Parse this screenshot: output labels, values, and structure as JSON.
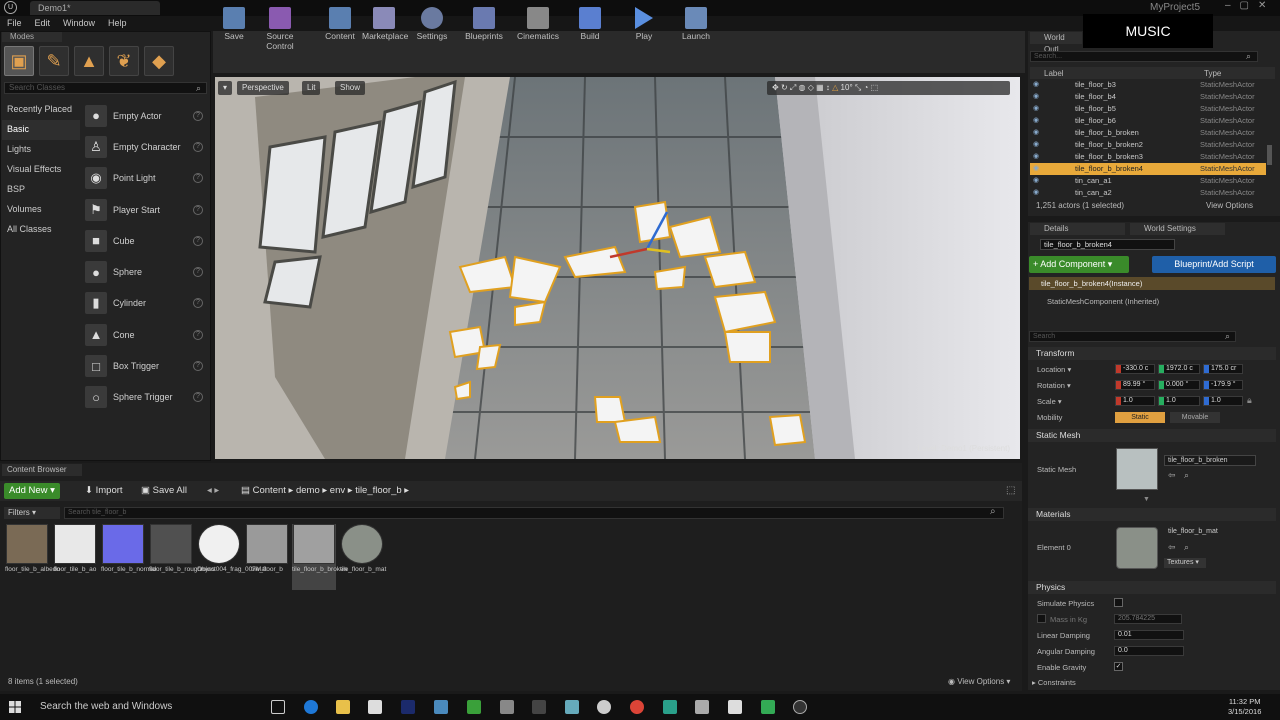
{
  "window": {
    "tab_title": "Demo1*",
    "project_name": "MyProject5",
    "menu": [
      "File",
      "Edit",
      "Window",
      "Help"
    ],
    "overlay_label": "MUSIC"
  },
  "modes": {
    "tab": "Modes",
    "search_placeholder": "Search Classes",
    "categories": [
      "Recently Placed",
      "Basic",
      "Lights",
      "Visual Effects",
      "BSP",
      "Volumes",
      "All Classes"
    ],
    "selected_category": "Basic",
    "classes": [
      "Empty Actor",
      "Empty Character",
      "Point Light",
      "Player Start",
      "Cube",
      "Sphere",
      "Cylinder",
      "Cone",
      "Box Trigger",
      "Sphere Trigger"
    ]
  },
  "toolbar": {
    "buttons": [
      "Save",
      "Source Control",
      "Content",
      "Marketplace",
      "Settings",
      "Blueprints",
      "Cinematics",
      "Build",
      "Play",
      "Launch"
    ]
  },
  "viewport": {
    "perspective": "Perspective",
    "lit": "Lit",
    "show": "Show",
    "snap_angle": "10°",
    "level_label": "Level: Demo1 (Persistent)"
  },
  "outliner": {
    "tabs": [
      "World Outl..."
    ],
    "search_placeholder": "Search...",
    "col_label": "Label",
    "col_type": "Type",
    "rows": [
      {
        "label": "tile_floor_b3",
        "type": "StaticMeshActor"
      },
      {
        "label": "tile_floor_b4",
        "type": "StaticMeshActor"
      },
      {
        "label": "tile_floor_b5",
        "type": "StaticMeshActor"
      },
      {
        "label": "tile_floor_b6",
        "type": "StaticMeshActor"
      },
      {
        "label": "tile_floor_b_broken",
        "type": "StaticMeshActor"
      },
      {
        "label": "tile_floor_b_broken2",
        "type": "StaticMeshActor"
      },
      {
        "label": "tile_floor_b_broken3",
        "type": "StaticMeshActor"
      },
      {
        "label": "tile_floor_b_broken4",
        "type": "StaticMeshActor"
      },
      {
        "label": "tin_can_a1",
        "type": "StaticMeshActor"
      },
      {
        "label": "tin_can_a2",
        "type": "StaticMeshActor"
      }
    ],
    "footer": "1,251 actors (1 selected)",
    "view_options": "View Options"
  },
  "details": {
    "tabs": [
      "Details",
      "World Settings"
    ],
    "actor_name": "tile_floor_b_broken4",
    "add_component": "+ Add Component ▾",
    "blueprint_script": "Blueprint/Add Script",
    "components": [
      "tile_floor_b_broken4(Instance)",
      "StaticMeshComponent (Inherited)"
    ],
    "search_placeholder": "Search",
    "transform": {
      "title": "Transform",
      "location_label": "Location ▾",
      "rotation_label": "Rotation ▾",
      "scale_label": "Scale ▾",
      "mobility_label": "Mobility",
      "location": [
        "-330.0 c",
        "1972.0 c",
        "175.0 cr"
      ],
      "rotation": [
        "89.99 °",
        "0.000 °",
        "-179.9 °"
      ],
      "scale": [
        "1.0",
        "1.0",
        "1.0"
      ],
      "static": "Static",
      "movable": "Movable"
    },
    "static_mesh": {
      "title": "Static Mesh",
      "label": "Static Mesh",
      "value": "tile_floor_b_broken"
    },
    "materials": {
      "title": "Materials",
      "label": "Element 0",
      "value": "tile_floor_b_mat",
      "textures": "Textures ▾"
    },
    "physics": {
      "title": "Physics",
      "simulate": "Simulate Physics",
      "mass": "Mass in Kg",
      "mass_value": "205.784225",
      "linear_damping": "Linear Damping",
      "linear_value": "0.01",
      "angular_damping": "Angular Damping",
      "angular_value": "0.0",
      "gravity": "Enable Gravity",
      "constraints": "Constraints"
    }
  },
  "content_browser": {
    "tab": "Content Browser",
    "add_new": "Add New ▾",
    "import": "Import",
    "save_all": "Save All",
    "breadcrumb": [
      "Content",
      "demo",
      "env",
      "tile_floor_b"
    ],
    "filters": "Filters ▾",
    "search_placeholder": "Search tile_floor_b",
    "assets": [
      {
        "name": "floor_tile_b_albedo",
        "color": "#7a6a55"
      },
      {
        "name": "floor_tile_b_ao",
        "color": "#e8e8e8"
      },
      {
        "name": "floor_tile_b_normal",
        "color": "#6a6ae8"
      },
      {
        "name": "floor_tile_b_roughness",
        "color": "#505050"
      },
      {
        "name": "Object004_frag_007Mat",
        "color": "#f0f0f0"
      },
      {
        "name": "tile_floor_b",
        "color": "#9a9a9a"
      },
      {
        "name": "tile_floor_b_broken",
        "color": "#a0a0a0"
      },
      {
        "name": "tile_floor_b_mat",
        "color": "#8a9088"
      }
    ],
    "status": "8 items (1 selected)",
    "view_options": "View Options ▾"
  },
  "taskbar": {
    "search": "Search the web and Windows",
    "time": "11:32 PM",
    "date": "3/15/2016"
  }
}
